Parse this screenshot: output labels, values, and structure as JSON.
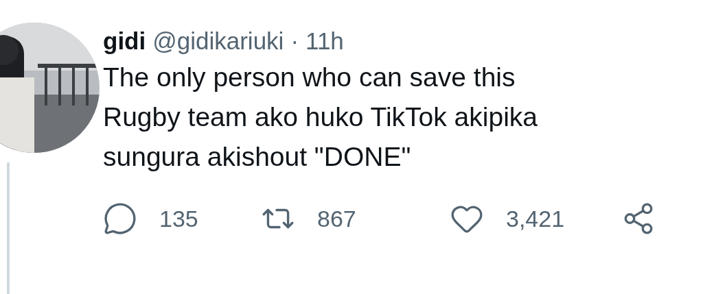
{
  "avatar": {
    "kind": "picture"
  },
  "author": {
    "name": "gidi",
    "handle": "@gidikariuki",
    "separator": "·",
    "time": "11h"
  },
  "text_lines": [
    "The only person who can save this",
    "Rugby team ako huko TikTok akipika",
    "sungura akishout \"DONE\""
  ],
  "actions": [
    {
      "kind": "reply",
      "count": "135"
    },
    {
      "kind": "retweet",
      "count": "867"
    },
    {
      "kind": "like",
      "count": "3,421"
    },
    {
      "kind": "share"
    }
  ]
}
